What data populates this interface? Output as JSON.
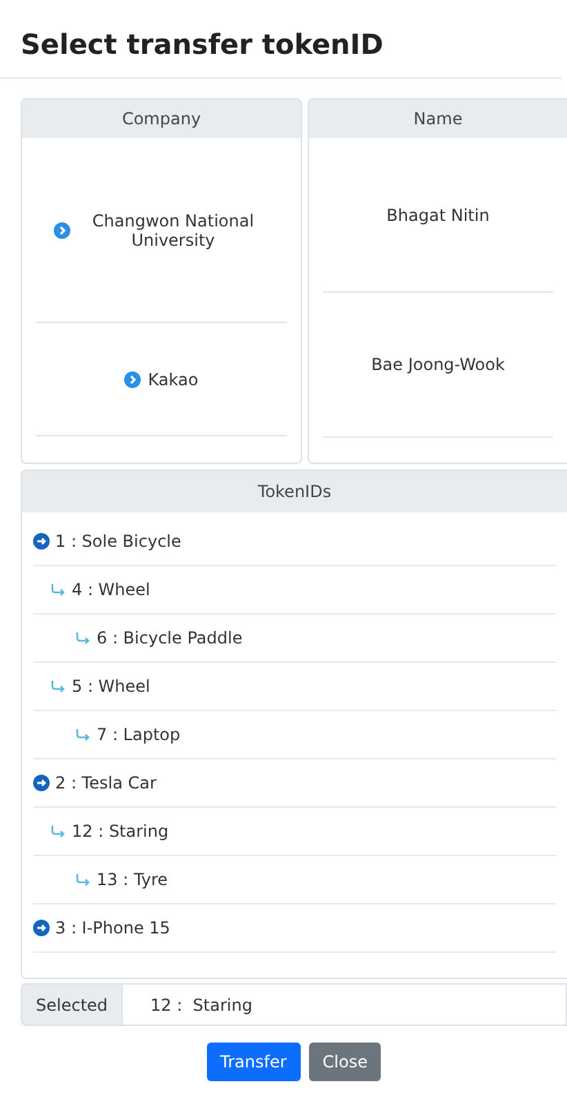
{
  "title": "Select transfer tokenID",
  "table": {
    "columns": [
      {
        "header": "Company",
        "cells": [
          "Changwon National University",
          "Kakao"
        ]
      },
      {
        "header": "Name",
        "cells": [
          "Bhagat Nitin",
          "Bae Joong-Wook"
        ]
      }
    ]
  },
  "tokens": {
    "header": "TokenIDs",
    "items": [
      {
        "label": "1 : Sole Bicycle",
        "children": [
          {
            "label": "4 : Wheel",
            "children": [
              {
                "label": "6 : Bicycle Paddle"
              }
            ]
          },
          {
            "label": "5 : Wheel",
            "children": [
              {
                "label": "7 : Laptop"
              }
            ]
          }
        ]
      },
      {
        "label": "2 : Tesla Car",
        "children": [
          {
            "label": "12 : Staring",
            "children": [
              {
                "label": "13 : Tyre"
              }
            ]
          }
        ]
      },
      {
        "label": "3 : I-Phone 15"
      }
    ]
  },
  "selected": {
    "label": "Selected",
    "value": "12 :  Staring"
  },
  "buttons": [
    {
      "label": "Transfer",
      "kind": "primary"
    },
    {
      "label": "Close",
      "kind": "secondary"
    }
  ]
}
